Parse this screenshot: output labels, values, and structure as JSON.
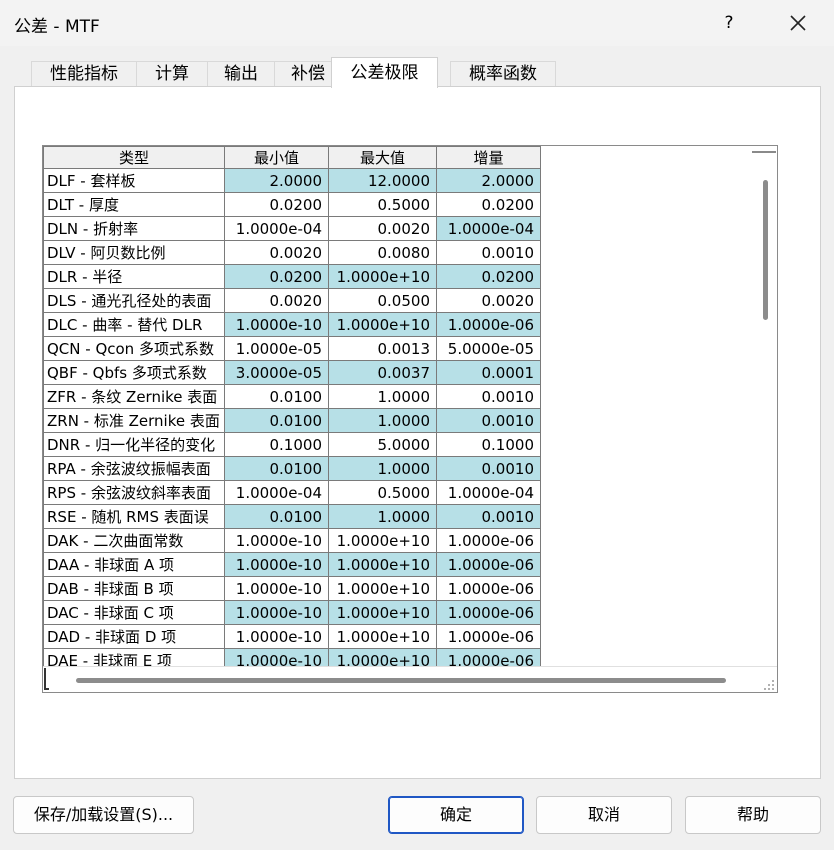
{
  "window": {
    "title": "公差 - MTF",
    "help": "?"
  },
  "tabs": [
    "性能指标",
    "计算",
    "输出",
    "补偿",
    "公差极限",
    "概率函数"
  ],
  "active_tab": 4,
  "table": {
    "headers": [
      "类型",
      "最小值",
      "最大值",
      "增量"
    ],
    "rows": [
      [
        "DLF - 套样板",
        "2.0000",
        "12.0000",
        "2.0000"
      ],
      [
        "DLT - 厚度",
        "0.0200",
        "0.5000",
        "0.0200"
      ],
      [
        "DLN - 折射率",
        "1.0000e-04",
        "0.0020",
        "1.0000e-04"
      ],
      [
        "DLV - 阿贝数比例",
        "0.0020",
        "0.0080",
        "0.0010"
      ],
      [
        "DLR - 半径",
        "0.0200",
        "1.0000e+10",
        "0.0200"
      ],
      [
        "DLS - 通光孔径处的表面",
        "0.0020",
        "0.0500",
        "0.0020"
      ],
      [
        "DLC - 曲率 - 替代 DLR",
        "1.0000e-10",
        "1.0000e+10",
        "1.0000e-06"
      ],
      [
        "QCN - Qcon 多项式系数",
        "1.0000e-05",
        "0.0013",
        "5.0000e-05"
      ],
      [
        "QBF - Qbfs 多项式系数",
        "3.0000e-05",
        "0.0037",
        "0.0001"
      ],
      [
        "ZFR - 条纹 Zernike 表面",
        "0.0100",
        "1.0000",
        "0.0010"
      ],
      [
        "ZRN - 标准 Zernike 表面",
        "0.0100",
        "1.0000",
        "0.0010"
      ],
      [
        "DNR - 归一化半径的变化",
        "0.1000",
        "5.0000",
        "0.1000"
      ],
      [
        "RPA - 余弦波纹振幅表面",
        "0.0100",
        "1.0000",
        "0.0010"
      ],
      [
        "RPS - 余弦波纹斜率表面",
        "1.0000e-04",
        "0.5000",
        "1.0000e-04"
      ],
      [
        "RSE - 随机 RMS 表面误",
        "0.0100",
        "1.0000",
        "0.0010"
      ],
      [
        "DAK - 二次曲面常数",
        "1.0000e-10",
        "1.0000e+10",
        "1.0000e-06"
      ],
      [
        "DAA - 非球面 A 项",
        "1.0000e-10",
        "1.0000e+10",
        "1.0000e-06"
      ],
      [
        "DAB - 非球面 B 项",
        "1.0000e-10",
        "1.0000e+10",
        "1.0000e-06"
      ],
      [
        "DAC - 非球面 C 项",
        "1.0000e-10",
        "1.0000e+10",
        "1.0000e-06"
      ],
      [
        "DAD - 非球面 D 项",
        "1.0000e-10",
        "1.0000e+10",
        "1.0000e-06"
      ],
      [
        "DAE - 非球面 E 项",
        "1.0000e-10",
        "1.0000e+10",
        "1.0000e-06"
      ]
    ],
    "highlight_color": "#b7e0e7",
    "highlighted_cells": [
      [
        0,
        1
      ],
      [
        0,
        2
      ],
      [
        0,
        3
      ],
      [
        2,
        3
      ],
      [
        4,
        1
      ],
      [
        4,
        2
      ],
      [
        4,
        3
      ],
      [
        6,
        1
      ],
      [
        6,
        2
      ],
      [
        6,
        3
      ],
      [
        8,
        1
      ],
      [
        8,
        2
      ],
      [
        8,
        3
      ],
      [
        10,
        1
      ],
      [
        10,
        2
      ],
      [
        10,
        3
      ],
      [
        12,
        1
      ],
      [
        12,
        2
      ],
      [
        12,
        3
      ],
      [
        14,
        1
      ],
      [
        14,
        2
      ],
      [
        14,
        3
      ],
      [
        16,
        1
      ],
      [
        16,
        2
      ],
      [
        16,
        3
      ],
      [
        18,
        1
      ],
      [
        18,
        2
      ],
      [
        18,
        3
      ],
      [
        20,
        1
      ],
      [
        20,
        2
      ],
      [
        20,
        3
      ]
    ]
  },
  "buttons": {
    "save_load": "保存/加载设置(S)...",
    "ok": "确定",
    "cancel": "取消",
    "help": "帮助"
  },
  "icons": {
    "close": "close-icon",
    "resize": "resize-grip-icon"
  }
}
